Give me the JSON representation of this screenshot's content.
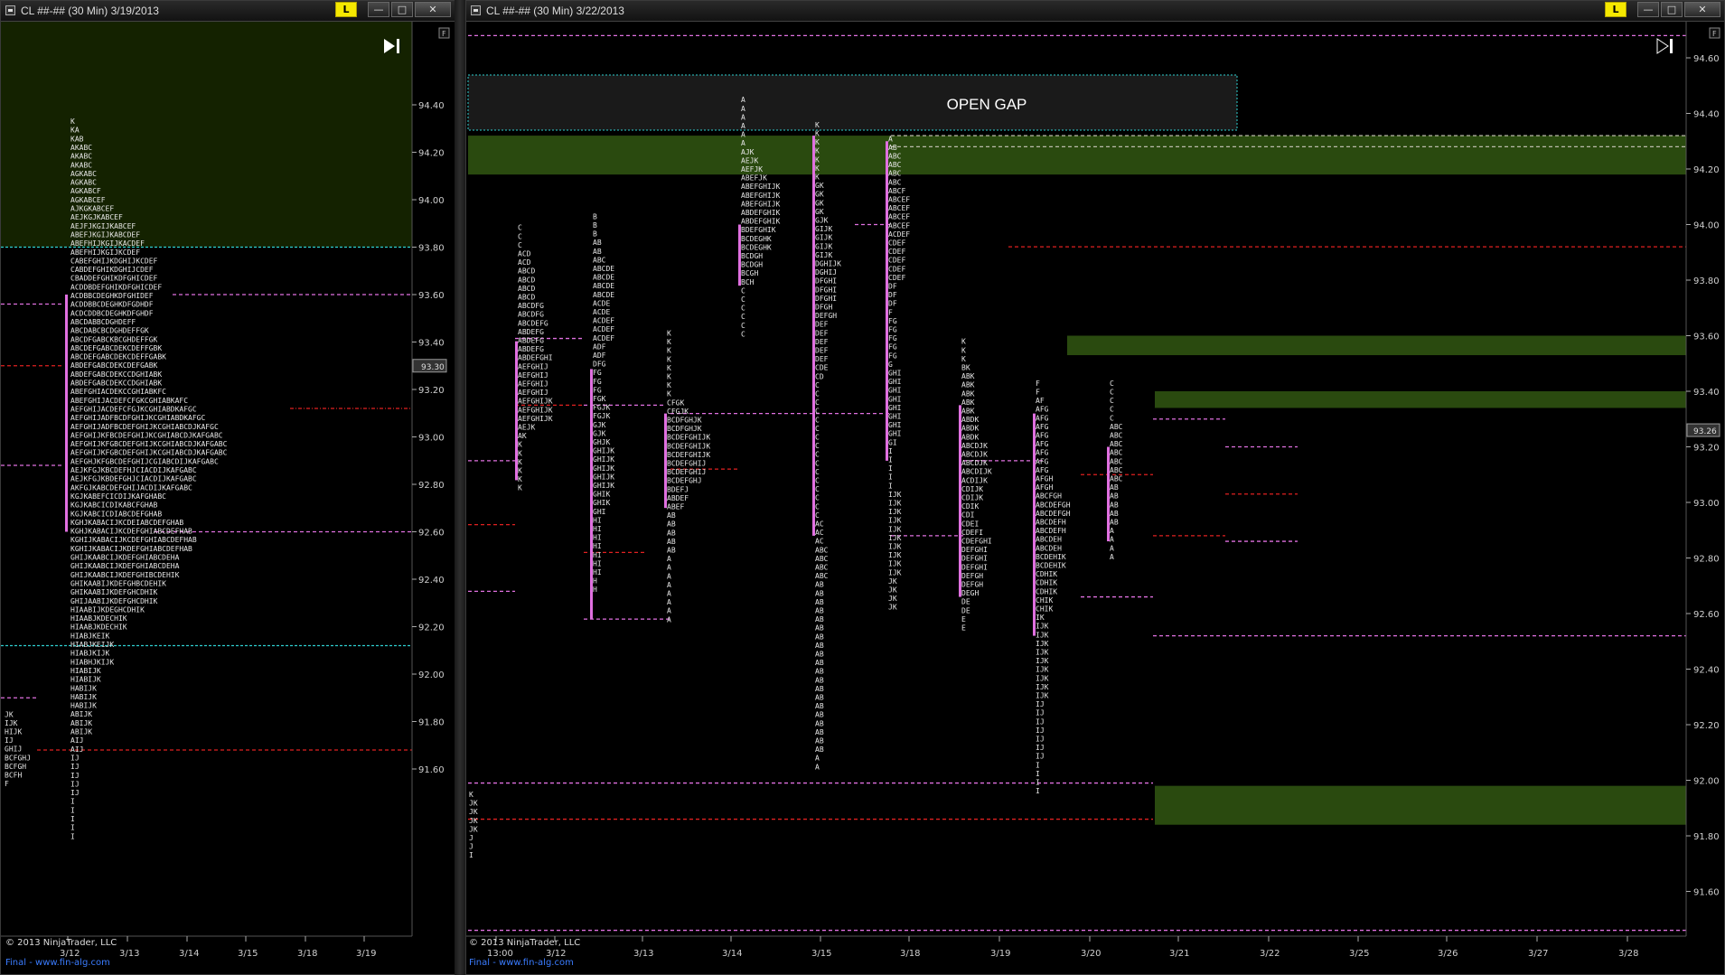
{
  "windows": [
    {
      "id": "left",
      "title": "CL ##-## (30 Min)  3/19/2013",
      "buttons": {
        "l_label": "L",
        "min_label": "—",
        "max_label": "□",
        "close_label": "✕"
      },
      "price_axis": [
        "94.40",
        "94.20",
        "94.00",
        "93.80",
        "93.60",
        "93.40",
        "93.20",
        "93.00",
        "92.80",
        "92.60",
        "92.40",
        "92.20",
        "92.00",
        "91.80",
        "91.60"
      ],
      "price_marker": "93.30",
      "date_axis": [
        "3/12",
        "3/13",
        "3/14",
        "3/15",
        "3/18",
        "3/19"
      ],
      "copyright": "© 2013 NinjaTrader, LLC",
      "footer_link": "Final - www.fin-alg.com",
      "f_button": "F",
      "play_icon": "play-end-icon"
    },
    {
      "id": "right",
      "title": "CL ##-## (30 Min)  3/22/2013",
      "buttons": {
        "l_label": "L",
        "min_label": "—",
        "max_label": "□",
        "close_label": "✕"
      },
      "price_axis": [
        "94.60",
        "94.40",
        "94.20",
        "94.00",
        "93.80",
        "93.60",
        "93.40",
        "93.20",
        "93.00",
        "92.80",
        "92.60",
        "92.40",
        "92.20",
        "92.00",
        "91.80",
        "91.60"
      ],
      "price_marker": "93.26",
      "date_axis": [
        "13:00",
        "3/12",
        "3/13",
        "3/14",
        "3/15",
        "3/18",
        "3/19",
        "3/20",
        "3/21",
        "3/22",
        "3/25",
        "3/26",
        "3/27",
        "3/28"
      ],
      "copyright": "© 2013 NinjaTrader, LLC",
      "footer_link": "Final - www.fin-alg.com",
      "f_button": "F",
      "annotation": "OPEN GAP",
      "play_icon": "play-end-icon"
    }
  ],
  "colors": {
    "background": "#000000",
    "green_zone": "#2a4a0f",
    "pink_line": "#e070e0",
    "red_line": "#e02020",
    "cyan_line": "#2ecfd0",
    "letters": "#e6e6e6",
    "highlight": "#ff2a2a",
    "link": "#3a7cff",
    "l_button": "#f5e800"
  },
  "profiles_left": [
    {
      "date": "3/12",
      "lines": [
        "K",
        "KA",
        "KAB",
        "AKABC",
        "AKABC",
        "AKABC",
        "AGKABC",
        "AGKABC",
        "AGKABCF",
        "AGKABCEF",
        "AJKGKABCEF",
        "AEJKGJKABCEF",
        "AEJFJKGIJKABCEF",
        "ABEFJKGIJKABCDEF",
        "ABEFHIJKGIJKACDEF",
        "ABEFHIJKGIJKCDEF",
        "CABEFGHIJKDGHIJKCDEF",
        "CABDEFGHIKDGHIJCDEF",
        "CBADDEFGHIKDFGHICDEF",
        "ACDDBDEFGHIKDFGHICDEF",
        "ACDBBCDEGHKDFGHIDEF",
        "ACDDBBCDEGHKDFGDHDF",
        "ACDCDDBCDEGHKDFGHDF",
        "ABCDABBCDGHDEFF",
        "ABCDABCBCDGHDEFFGK",
        "ABCDFGABCKBCGHDEFFGK",
        "ABCDEFGABCDEKCDEFFGBK",
        "ABCDEFGABCDEKCDEFFGABK",
        "ABDEFGABCDEKCDEFGABK",
        "ABDEFGABCDEKCCDGHIABK",
        "ABDEFGABCDEKCCDGHIABK",
        "ABEFGHIACDEKCCGHIABKFC",
        "ABEFGHIJACDEFCFGKCGHIABKAFC",
        "AEFGHIJACDEFCFGJKCGHIABDKAFGC",
        "AEFGHIJADFBCDFGHIJKCGHIABDKAFGC",
        "AEFGHIJADFBCDEFGHIJKCGHIABCDJKAFGC",
        "AEFGHIJKFBCDEFGHIJKCGHIABCDJKAFGABC",
        "AEFGHIJKFGBCDEFGHIJKCGHIABCDJKAFGABC",
        "AEFGHIJKFGBCDEFGHIJKCGHIABCDJKAFGABC",
        "AEFGHJKFGBCDEFGHIJCGIABCDIJKAFGABC",
        "AEJKFGJKBCDEFHJCIACDIJKAFGABC",
        "AEJKFGJKBDEFGHJCIACDIJKAFGABC",
        "AKFGJKABCDEFGHIJACDIJKAFGABC",
        "KGJKABEFCICDIJKAFGHABC",
        "KGJKABCICDIKABCFGHAB",
        "KGJKABCICDIABCDEFGHAB",
        "KGHJKABACIJKCDEIABCDEFGHAB",
        "KGHJKABACIJKCDEFGHIABCDEFHAB",
        "KGHIJKABACIJKCDEFGHIABCDEFHAB",
        "KGHIJKABACIJKDEFGHIABCDEFHAB",
        "GHIJKAABCIJKDEFGHIABCDEHA",
        "GHIJKAABCIJKDEFGHIABCDEHA",
        "GHIJKAABCIJKDEFGHIBCDEHIK",
        "GHIKAABIJKDEFGHBCDEHIK",
        "GHIKAABIJKDEFGHCDHIK",
        "GHIJAABIJKDEFGHCDHIK",
        "HIAABIJKDEGHCDHIK",
        "HIAABJKDECHIK",
        "HIAABJKDECHIK",
        "HIABJKEIK",
        "HIABJKEIJK",
        "HIABJKIJK",
        "HIABHJKIJK",
        "HIABIJK",
        "HIABIJK",
        "HABIJK",
        "HABIJK",
        "HABIJK",
        "ABIJK",
        "ABIJK",
        "ABIJK",
        "AIJ",
        "AIJ",
        "IJ",
        "IJ",
        "IJ",
        "IJ",
        "IJ",
        "I",
        "I",
        "I",
        "I",
        "I"
      ]
    }
  ],
  "profiles_right": [
    {
      "date": "3/12",
      "lines": [
        "C",
        "C",
        "C",
        "ACD",
        "ACD",
        "ABCD",
        "ABCD",
        "ABCD",
        "ABCD",
        "ABCDFG",
        "ABCDFG",
        "ABCDEFG",
        "ABDEFG",
        "ABDEFG",
        "ABDEFG",
        "ABDEFGHI",
        "AEFGHIJ",
        "AEFGHIJ",
        "AEFGHIJ",
        "AEFGHIJ",
        "AEFGHIJK",
        "AEFGHIJK",
        "AEFGHIJK",
        "AEJK",
        "AK",
        "K",
        "K",
        "K",
        "K",
        "K",
        "K"
      ]
    },
    {
      "date": "3/13",
      "lines": [
        "B",
        "B",
        "B",
        "AB",
        "AB",
        "ABC",
        "ABCDE",
        "ABCDE",
        "ABCDE",
        "ABCDE",
        "ACDE",
        "ACDE",
        "ACDEF",
        "ACDEF",
        "ACDEF",
        "ADF",
        "ADF",
        "DFG",
        "FG",
        "FG",
        "FG",
        "FGK",
        "FGJK",
        "FGJK",
        "GJK",
        "GJK",
        "GHJK",
        "GHIJK",
        "GHIJK",
        "GHIJK",
        "GHIJK",
        "GHIJK",
        "GHIK",
        "GHIK",
        "GHI",
        "HI",
        "HI",
        "HI",
        "HI",
        "HI",
        "HI",
        "HI",
        "H",
        "H"
      ]
    },
    {
      "date": "3/14",
      "lines": [
        "K",
        "K",
        "K",
        "K",
        "K",
        "K",
        "K",
        "K",
        "CFGK",
        "CFGJK",
        "BCDFGHJK",
        "BCDFGHJK",
        "BCDEFGHIJK",
        "BCDEFGHIJK",
        "BCDEFGHIJK",
        "BCDEFGHIJ",
        "BCDEFGHIJ",
        "BCDEFGHJ",
        "BDEFJ",
        "ABDEF",
        "ABEF",
        "AB",
        "AB",
        "AB",
        "AB",
        "AB",
        "A",
        "A",
        "A",
        "A",
        "A",
        "A",
        "A",
        "A"
      ]
    },
    {
      "date": "3/15",
      "lines": [
        "A",
        "A",
        "A",
        "A",
        "A",
        "A",
        "AJK",
        "AEJK",
        "AEFJK",
        "ABEFJK",
        "ABEFGHIJK",
        "ABEFGHIJK",
        "ABEFGHIJK",
        "ABDEFGHIK",
        "ABDEFGHIK",
        "BDEFGHIK",
        "BCDEGHK",
        "BCDEGHK",
        "BCDGH",
        "BCDGH",
        "BCGH",
        "BCH",
        "C",
        "C",
        "C",
        "C",
        "C",
        "C"
      ]
    },
    {
      "date": "3/18",
      "lines": [
        "K",
        "K",
        "K",
        "K",
        "K",
        "K",
        "K",
        "GK",
        "GK",
        "GK",
        "GK",
        "GJK",
        "GIJK",
        "GIJK",
        "GIJK",
        "GIJK",
        "DGHIJK",
        "DGHIJ",
        "DFGHI",
        "DFGHI",
        "DFGHI",
        "DFGH",
        "DEFGH",
        "DEF",
        "DEF",
        "DEF",
        "DEF",
        "DEF",
        "CDE",
        "CD",
        "C",
        "C",
        "C",
        "C",
        "C",
        "C",
        "C",
        "C",
        "C",
        "C",
        "C",
        "C",
        "C",
        "C",
        "C",
        "C",
        "AC",
        "AC",
        "AC",
        "ABC",
        "ABC",
        "ABC",
        "ABC",
        "AB",
        "AB",
        "AB",
        "AB",
        "AB",
        "AB",
        "AB",
        "AB",
        "AB",
        "AB",
        "AB",
        "AB",
        "AB",
        "AB",
        "AB",
        "AB",
        "AB",
        "AB",
        "AB",
        "AB",
        "A",
        "A"
      ]
    },
    {
      "date": "3/19",
      "lines": [
        "A",
        "AB",
        "ABC",
        "ABC",
        "ABC",
        "ABC",
        "ABCF",
        "ABCEF",
        "ABCEF",
        "ABCEF",
        "ABCEF",
        "ACDEF",
        "CDEF",
        "CDEF",
        "CDEF",
        "CDEF",
        "CDEF",
        "DF",
        "DF",
        "DF",
        "F",
        "FG",
        "FG",
        "FG",
        "FG",
        "FG",
        "G",
        "GHI",
        "GHI",
        "GHI",
        "GHI",
        "GHI",
        "GHI",
        "GHI",
        "GHI",
        "GI",
        "I",
        "I",
        "I",
        "I",
        "I",
        "IJK",
        "IJK",
        "IJK",
        "IJK",
        "IJK",
        "IJK",
        "IJK",
        "IJK",
        "IJK",
        "IJK",
        "JK",
        "JK",
        "JK",
        "JK"
      ]
    },
    {
      "date": "3/20",
      "lines": [
        "K",
        "K",
        "K",
        "BK",
        "ABK",
        "ABK",
        "ABK",
        "ABK",
        "ABK",
        "ABDK",
        "ABDK",
        "ABDK",
        "ABCDJK",
        "ABCDJK",
        "ABCDJK",
        "ABCDIJK",
        "ACDIJK",
        "CDIJK",
        "CDIJK",
        "CDIK",
        "CDI",
        "CDEI",
        "CDEFI",
        "CDEFGHI",
        "DEFGHI",
        "DEFGHI",
        "DEFGHI",
        "DEFGH",
        "DEFGH",
        "DEGH",
        "DE",
        "DE",
        "E",
        "E"
      ]
    },
    {
      "date": "3/21",
      "lines": [
        "F",
        "F",
        "AF",
        "AFG",
        "AFG",
        "AFG",
        "AFG",
        "AFG",
        "AFG",
        "AFG",
        "AFG",
        "AFGH",
        "AFGH",
        "ABCFGH",
        "ABCDEFGH",
        "ABCDEFGH",
        "ABCDEFH",
        "ABCDEFH",
        "ABCDEH",
        "ABCDEH",
        "BCDEHIK",
        "BCDEHIK",
        "CDHIK",
        "CDHIK",
        "CDHIK",
        "CHIK",
        "CHIK",
        "IK",
        "IJK",
        "IJK",
        "IJK",
        "IJK",
        "IJK",
        "IJK",
        "IJK",
        "IJK",
        "IJK",
        "IJ",
        "IJ",
        "IJ",
        "IJ",
        "IJ",
        "IJ",
        "IJ",
        "I",
        "I",
        "I",
        "I"
      ]
    },
    {
      "date": "3/22",
      "lines": [
        "C",
        "C",
        "C",
        "C",
        "C",
        "ABC",
        "ABC",
        "ABC",
        "ABC",
        "ABC",
        "ABC",
        "ABC",
        "AB",
        "AB",
        "AB",
        "AB",
        "AB",
        "A",
        "A",
        "A",
        "A"
      ]
    }
  ],
  "prior_profile_right": [
    "K",
    "JK",
    "JK",
    "JK",
    "JK",
    "J",
    "J",
    "I"
  ],
  "prior_profile_left": [
    "JK",
    "IJK",
    "HIJK",
    "IJ",
    "GHIJ",
    "BCFGHJ",
    "BCFGH",
    "BCFH",
    "F"
  ]
}
